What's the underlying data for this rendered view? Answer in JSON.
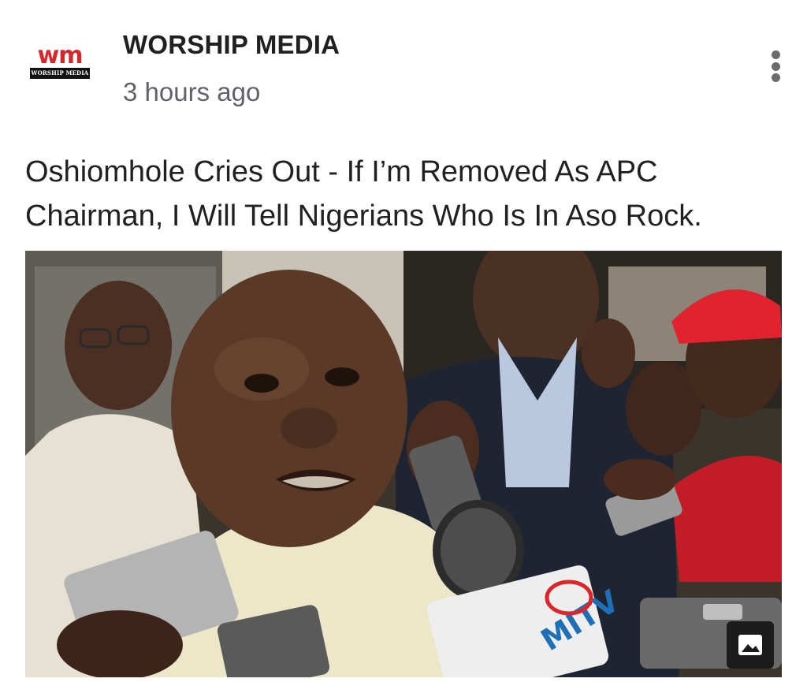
{
  "card": {
    "source": {
      "name": "WORSHIP MEDIA",
      "logo_letters": "wm",
      "logo_caption": "WORSHIP MEDIA"
    },
    "timestamp": "3 hours ago",
    "headline": "Oshiomhole Cries Out - If I’m Removed As APC Chairman, I Will Tell Nigerians Who Is In Aso Rock.",
    "image": {
      "microphone_label": "MITV"
    }
  },
  "icons": {
    "menu": "more-vert-icon",
    "image_badge": "image-icon"
  },
  "colors": {
    "logo_red": "#d9262b",
    "timestamp_gray": "#5f6368",
    "badge_background": "#1b1b1b"
  }
}
